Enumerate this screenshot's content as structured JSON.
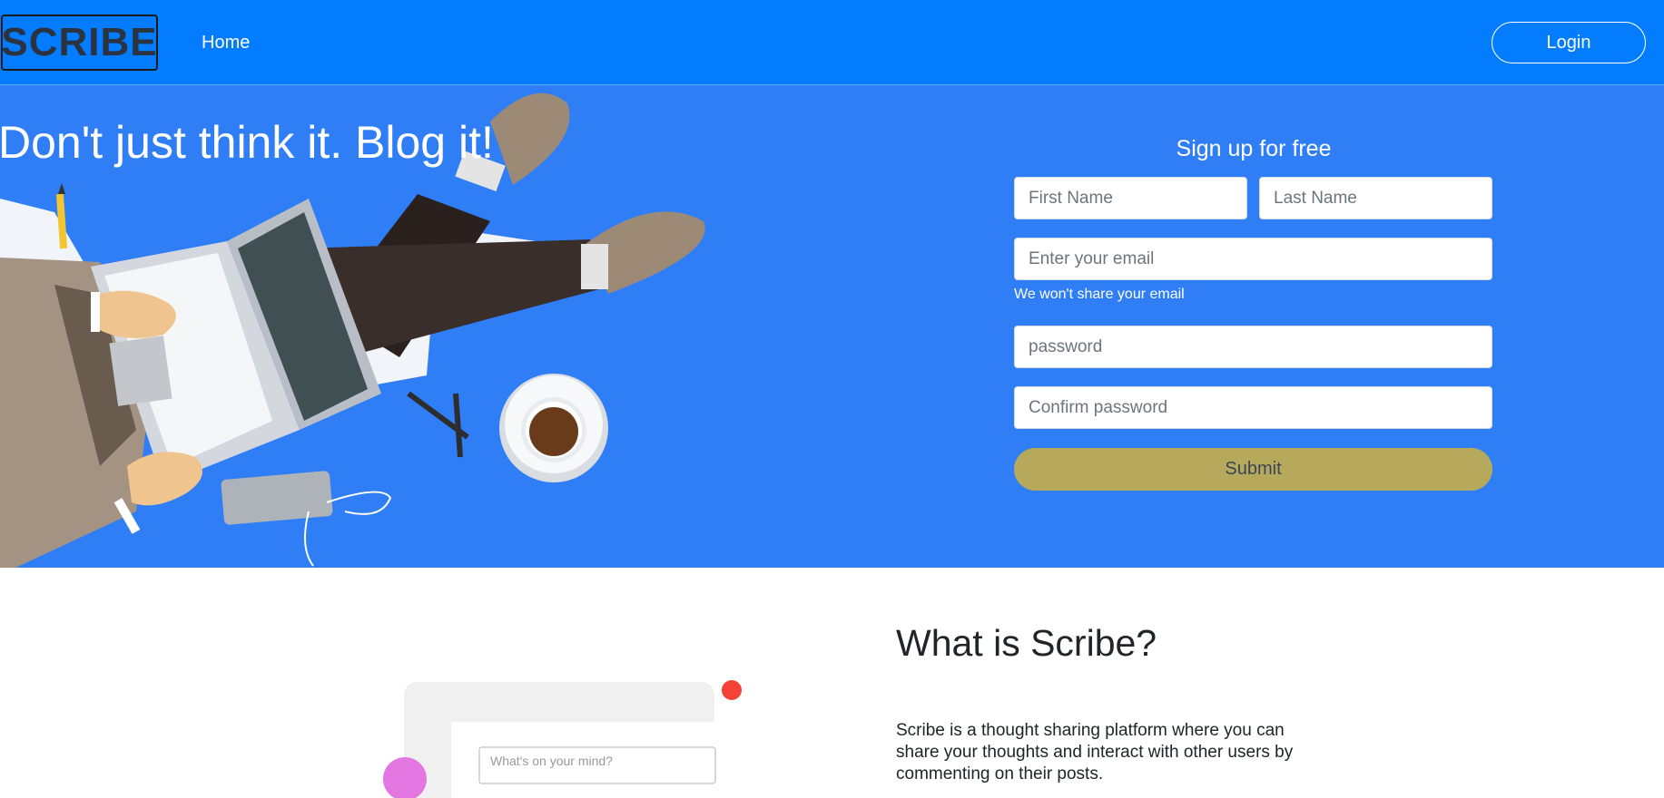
{
  "nav": {
    "logo_text": "SCRIBE",
    "home_label": "Home",
    "login_label": "Login"
  },
  "hero": {
    "title": "Don't just think it. Blog it!"
  },
  "signup": {
    "title": "Sign up for free",
    "first_name_placeholder": "First Name",
    "last_name_placeholder": "Last Name",
    "email_placeholder": "Enter your email",
    "email_help": "We won't share your email",
    "password_placeholder": "password",
    "confirm_password_placeholder": "Confirm password",
    "submit_label": "Submit"
  },
  "about": {
    "title": "What is Scribe?",
    "description": "Scribe is a thought sharing platform where you can share your thoughts and interact with other users by commenting on their posts.",
    "mock_input_placeholder": "What's on your mind?"
  },
  "colors": {
    "navbar": "#037cff",
    "hero_background": "#2f7ef6",
    "submit_button": "#b7a95c"
  }
}
